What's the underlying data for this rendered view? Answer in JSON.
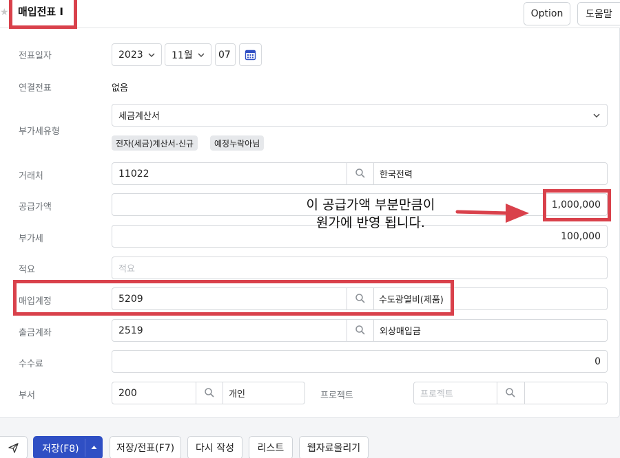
{
  "header": {
    "title": "매입전표 I",
    "option_label": "Option",
    "help_label": "도움말"
  },
  "form": {
    "date": {
      "label": "전표일자",
      "year": "2023",
      "month": "11월",
      "day": "07"
    },
    "linked": {
      "label": "연결전표",
      "value": "없음"
    },
    "vat_type": {
      "label": "부가세유형",
      "value": "세금계산서",
      "tags": [
        "전자(세금)계산서-신규",
        "예정누락아님"
      ]
    },
    "vendor": {
      "label": "거래처",
      "code": "11022",
      "name": "한국전력"
    },
    "supply": {
      "label": "공급가액",
      "value": "1,000,000"
    },
    "vat": {
      "label": "부가세",
      "value": "100,000"
    },
    "memo": {
      "label": "적요",
      "placeholder": "적요"
    },
    "account": {
      "label": "매입계정",
      "code": "5209",
      "name": "수도광열비(제품)"
    },
    "payment": {
      "label": "출금계좌",
      "code": "2519",
      "name": "외상매입금"
    },
    "fee": {
      "label": "수수료",
      "value": "0"
    },
    "dept": {
      "label": "부서",
      "code": "200",
      "name": "개인"
    },
    "project": {
      "label": "프로젝트",
      "placeholder": "프로젝트"
    }
  },
  "annotation": {
    "line1": "이 공급가액 부분만큼이",
    "line2": "원가에 반영 됩니다."
  },
  "toolbar": {
    "save_label": "저장(F8)",
    "save_slip_label": "저장/전표(F7)",
    "rewrite_label": "다시 작성",
    "list_label": "리스트",
    "upload_label": "웹자료올리기"
  },
  "colors": {
    "accent": "#2f4fc4",
    "annotation_red": "#d9414b",
    "label_gray": "#6e7378"
  }
}
